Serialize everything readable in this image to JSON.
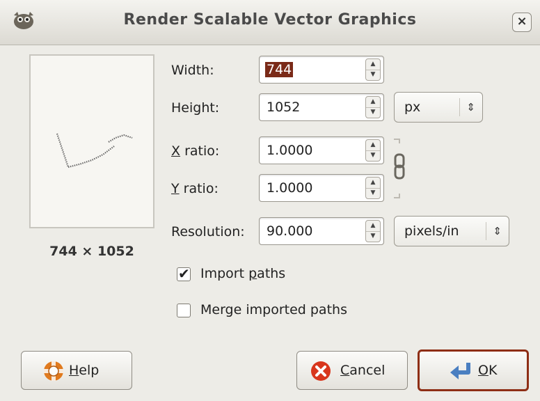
{
  "window": {
    "title": "Render Scalable Vector Graphics",
    "icon": "gimp-icon",
    "close_label": "×"
  },
  "preview": {
    "size_text": "744 × 1052"
  },
  "fields": {
    "width": {
      "label_pre": "Width:",
      "value": "744"
    },
    "height": {
      "label_pre": "Height:",
      "value": "1052"
    },
    "x_ratio": {
      "mnemonic": "X",
      "label_rest": " ratio:",
      "value": "1.0000"
    },
    "y_ratio": {
      "mnemonic": "Y",
      "label_rest": " ratio:",
      "value": "1.0000"
    },
    "resolution": {
      "label_pre": "Resolution:",
      "value": "90.000"
    }
  },
  "units": {
    "size_unit": "px",
    "resolution_unit": "pixels/in"
  },
  "options": {
    "import_paths": {
      "label_pre": "Import ",
      "mnemonic": "p",
      "label_rest": "aths",
      "checked": true
    },
    "merge_paths": {
      "label": "Merge imported paths",
      "checked": false
    }
  },
  "buttons": {
    "help": {
      "mnemonic": "H",
      "label_rest": "elp"
    },
    "cancel": {
      "mnemonic": "C",
      "label_rest": "ancel"
    },
    "ok": {
      "mnemonic": "O",
      "label_rest": "K"
    }
  },
  "spin_glyphs": {
    "up": "▲",
    "down": "▼"
  },
  "combo_glyph": "⇕",
  "check_glyph": "✔",
  "colors": {
    "selection": "#7a2a18",
    "default_border": "#8e2e15",
    "cancel_red": "#d8361c",
    "help_orange": "#e07a1e",
    "ok_blue": "#4a7fc1"
  }
}
